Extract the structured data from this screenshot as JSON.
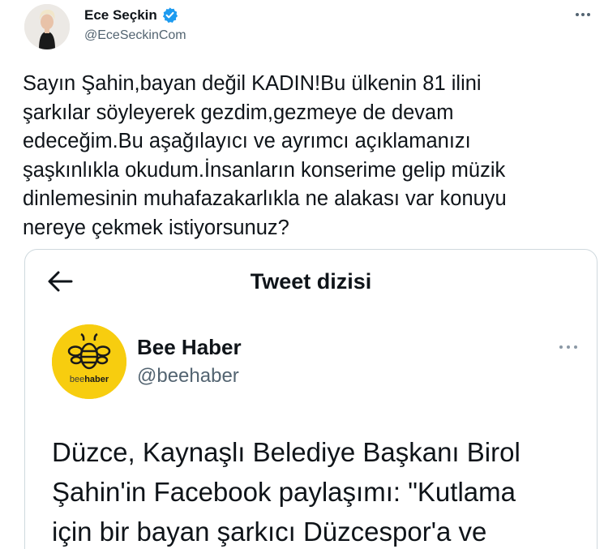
{
  "tweet": {
    "display_name": "Ece Seçkin",
    "handle": "@EceSeckinCom",
    "verified_icon": "verified-badge-icon",
    "more_icon": "more-options-icon",
    "text": "Sayın Şahin,bayan değil KADIN!Bu ülkenin 81 ilini\nşarkılar söyleyerek gezdim,gezmeye de devam\nedeceğim.Bu aşağılayıcı ve ayrımcı açıklamanızı\nşaşkınlıkla okudum.İnsanların konserime gelip müzik\ndinlemesinin muhafazakarlıkla ne alakası var konuyu\nnereye çekmek istiyorsunuz?"
  },
  "embedded_screenshot": {
    "header_title": "Tweet dizisi",
    "back_icon": "back-arrow-icon",
    "account": {
      "display_name": "Bee Haber",
      "handle": "@beehaber",
      "logo_text_bee": "bee",
      "logo_text_haber": "haber"
    },
    "text": "Düzce, Kaynaşlı Belediye Başkanı Birol\nŞahin'in Facebook paylaşımı: \"Kutlama\niçin bir bayan şarkıcı Düzcespor'a ve"
  },
  "colors": {
    "text_primary": "#0f1419",
    "text_secondary": "#536471",
    "verified_blue": "#1d9bf0",
    "border": "#cfd9de",
    "bee_yellow": "#f7cd0f"
  }
}
